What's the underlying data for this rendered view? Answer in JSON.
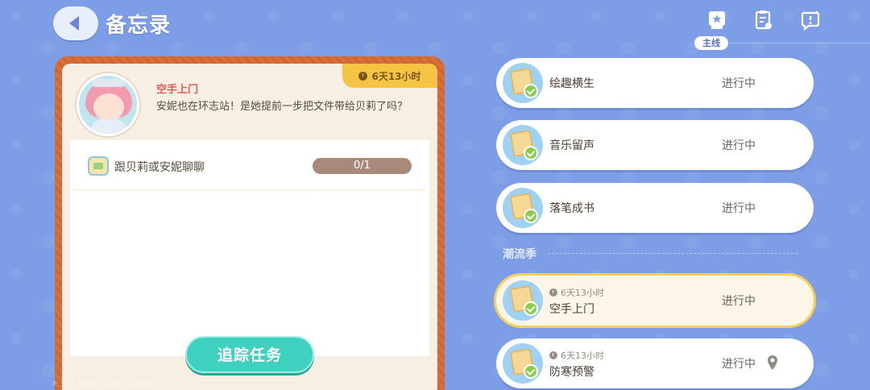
{
  "header": {
    "title": "备忘录",
    "active_tab_label": "主线",
    "icons": [
      "main-quest-icon",
      "memo-list-icon",
      "help-icon"
    ]
  },
  "detail": {
    "time_left": "6天13小时",
    "quest_name": "空手上门",
    "description": "安妮也在环志站！是她提前一步把文件带给贝莉了吗？",
    "task": {
      "text": "跟贝莉或安妮聊聊",
      "progress": "0/1"
    },
    "track_button": "追踪任务",
    "debug_text": "F: 30   T: 0.00   P: 47   ID: qc6h84n"
  },
  "quests_top": [
    {
      "name": "绘趣横生",
      "status": "进行中"
    },
    {
      "name": "音乐留声",
      "status": "进行中"
    },
    {
      "name": "落笔成书",
      "status": "进行中"
    }
  ],
  "section": {
    "label": "潮流季"
  },
  "quests_season": [
    {
      "time": "6天13小时",
      "name": "空手上门",
      "status": "进行中",
      "active": true
    },
    {
      "time": "6天13小时",
      "name": "防寒预警",
      "status": "进行中",
      "has_pin": true
    }
  ],
  "colors": {
    "background": "#7d9ee6",
    "panel_border": "#d9703a",
    "accent_teal": "#3fd1bf",
    "time_tag": "#f5c445",
    "active_outline": "#f7cf5a"
  }
}
